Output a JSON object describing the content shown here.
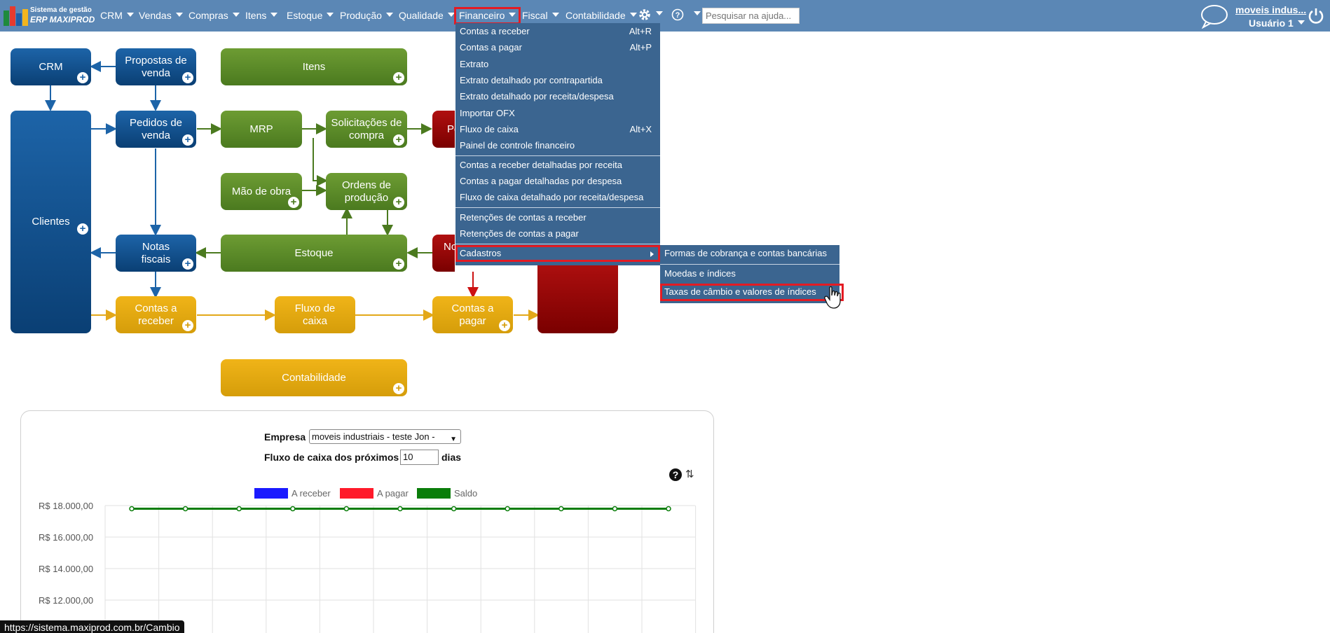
{
  "app": {
    "logo_line1": "Sistema de gestão",
    "logo_line2": "ERP MAXIPROD"
  },
  "nav": {
    "items": [
      {
        "label": "CRM"
      },
      {
        "label": "Vendas"
      },
      {
        "label": "Compras"
      },
      {
        "label": "Itens"
      },
      {
        "label": "Estoque"
      },
      {
        "label": "Produção"
      },
      {
        "label": "Qualidade"
      },
      {
        "label": "Financeiro"
      },
      {
        "label": "Fiscal"
      },
      {
        "label": "Contabilidade"
      }
    ],
    "search_placeholder": "Pesquisar na ajuda...",
    "company_link": "moveis indus...",
    "user": "Usuário 1"
  },
  "diagram": {
    "crm": "CRM",
    "propostas": "Propostas de venda",
    "itens": "Itens",
    "clientes": "Clientes",
    "pedidos": "Pedidos de venda",
    "mrp": "MRP",
    "solicitacoes": "Solicitações de compra",
    "pe": "Pe",
    "mao_obra": "Mão de obra",
    "ordens": "Ordens de produção",
    "notas": "Notas fiscais",
    "estoque": "Estoque",
    "no": "No",
    "contas_receber": "Contas a receber",
    "fluxo": "Fluxo de caixa",
    "contas_pagar": "Contas a pagar",
    "contabilidade": "Contabilidade"
  },
  "dropdown": {
    "items": [
      {
        "label": "Contas a receber",
        "shortcut": "Alt+R"
      },
      {
        "label": "Contas a pagar",
        "shortcut": "Alt+P"
      },
      {
        "label": "Extrato",
        "shortcut": ""
      },
      {
        "label": "Extrato detalhado por contrapartida",
        "shortcut": ""
      },
      {
        "label": "Extrato detalhado por receita/despesa",
        "shortcut": ""
      },
      {
        "label": "Importar OFX",
        "shortcut": ""
      },
      {
        "label": "Fluxo de caixa",
        "shortcut": "Alt+X"
      },
      {
        "label": "Painel de controle financeiro",
        "shortcut": ""
      },
      {
        "label": "Contas a receber detalhadas por receita",
        "shortcut": ""
      },
      {
        "label": "Contas a pagar detalhadas por despesa",
        "shortcut": ""
      },
      {
        "label": "Fluxo de caixa detalhado por receita/despesa",
        "shortcut": ""
      },
      {
        "label": "Retenções de contas a receber",
        "shortcut": ""
      },
      {
        "label": "Retenções de contas a pagar",
        "shortcut": ""
      },
      {
        "label": "Cadastros",
        "shortcut": ""
      }
    ]
  },
  "submenu": {
    "items": [
      {
        "label": "Formas de cobrança e contas bancárias"
      },
      {
        "label": "Moedas e índices"
      },
      {
        "label": "Taxas de câmbio e valores de índices"
      }
    ]
  },
  "panel": {
    "empresa_label": "Empresa",
    "empresa_value": "moveis industriais - teste Jon -",
    "fluxo_label": "Fluxo de caixa dos próximos",
    "dias_value": "10",
    "dias_label": "dias"
  },
  "chart_data": {
    "type": "line",
    "legend": [
      {
        "name": "A receber",
        "color": "#1a1aff"
      },
      {
        "name": "A pagar",
        "color": "#ff1a2a"
      },
      {
        "name": "Saldo",
        "color": "#0a7d0a"
      }
    ],
    "y_tick_labels": [
      "R$ 18.000,00",
      "R$ 16.000,00",
      "R$ 14.000,00",
      "R$ 12.000,00"
    ],
    "y_ticks": [
      18000,
      16000,
      14000,
      12000
    ],
    "series": [
      {
        "name": "Saldo",
        "values": [
          17800,
          17800,
          17800,
          17800,
          17800,
          17800,
          17800,
          17800,
          17800,
          17800,
          17800
        ]
      }
    ],
    "grid": true,
    "legend_position": "top"
  },
  "status": {
    "url": "https://sistema.maxiprod.com.br/Cambio"
  },
  "colors": {
    "topbar": "#5b87b5",
    "menu_bg": "#3b6590",
    "highlight": "#e41b23"
  }
}
